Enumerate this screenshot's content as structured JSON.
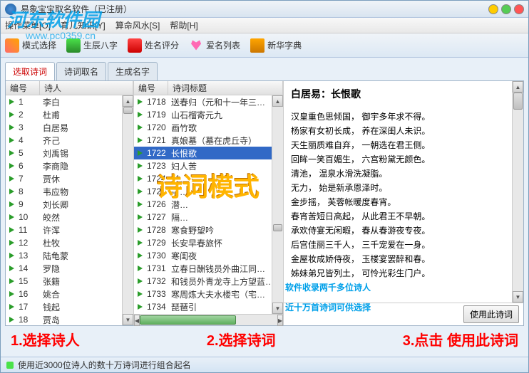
{
  "window": {
    "title": "易象宝宝取名软件（已注册）"
  },
  "menu": {
    "op": "操作菜单[O]",
    "child": "育儿知识[Y]",
    "fengshui": "算命风水[S]",
    "help": "帮助[H]"
  },
  "toolbar": {
    "mode": "模式选择",
    "bazi": "生辰八字",
    "score": "姓名评分",
    "love": "爱名列表",
    "dict": "新华字典"
  },
  "tabs": {
    "t1": "选取诗词",
    "t2": "诗词取名",
    "t3": "生成名字"
  },
  "headers": {
    "no": "编号",
    "poet": "诗人",
    "title": "诗词标题"
  },
  "poets": [
    {
      "n": "1",
      "name": "李白"
    },
    {
      "n": "2",
      "name": "杜甫"
    },
    {
      "n": "3",
      "name": "白居易"
    },
    {
      "n": "4",
      "name": "齐己"
    },
    {
      "n": "5",
      "name": "刘禹锡"
    },
    {
      "n": "6",
      "name": "李商隐"
    },
    {
      "n": "7",
      "name": "贾休"
    },
    {
      "n": "8",
      "name": "韦应物"
    },
    {
      "n": "9",
      "name": "刘长卿"
    },
    {
      "n": "10",
      "name": "皎然"
    },
    {
      "n": "11",
      "name": "许浑"
    },
    {
      "n": "12",
      "name": "杜牧"
    },
    {
      "n": "13",
      "name": "陆龟蒙"
    },
    {
      "n": "14",
      "name": "罗隐"
    },
    {
      "n": "15",
      "name": "张籍"
    },
    {
      "n": "16",
      "name": "姚合"
    },
    {
      "n": "17",
      "name": "钱起"
    },
    {
      "n": "18",
      "name": "贾岛"
    }
  ],
  "poems": [
    {
      "n": "1718",
      "t": "送春归（元和十一年三…"
    },
    {
      "n": "1719",
      "t": "山石榴寄元九"
    },
    {
      "n": "1720",
      "t": "画竹歌"
    },
    {
      "n": "1721",
      "t": "真娘墓（墓在虎丘寺）"
    },
    {
      "n": "1722",
      "t": "长恨歌",
      "sel": true
    },
    {
      "n": "1723",
      "t": "妇人苦"
    },
    {
      "n": "1724",
      "t": "长…"
    },
    {
      "n": "1725",
      "t": "昆…"
    },
    {
      "n": "1726",
      "t": "潜…"
    },
    {
      "n": "1727",
      "t": "隔…"
    },
    {
      "n": "1728",
      "t": "寒食野望吟"
    },
    {
      "n": "1729",
      "t": "长安早春旅怀"
    },
    {
      "n": "1730",
      "t": "寒闺夜"
    },
    {
      "n": "1731",
      "t": "立春日酬钱员外曲江同…"
    },
    {
      "n": "1732",
      "t": "和钱员外青龙寺上方望蓝…"
    },
    {
      "n": "1733",
      "t": "寒周炼大夫水楼宅（宅…"
    },
    {
      "n": "1734",
      "t": "琵琶引"
    }
  ],
  "poem": {
    "head": "白居易：长恨歌",
    "lines": [
      "汉皇重色思倾国，    御宇多年求不得。",
      "杨家有女初长成，    养在深闺人未识。",
      "天生丽质难自弃，    一朝选在君王侧。",
      "回眸一笑百媚生，    六宫粉黛无颜色。",
      "            清池，    温泉水滑洗凝脂。",
      "            无力，    始是新承恩泽时。",
      "            金步摇，  芙蓉帐暖度春宵。",
      "春宵苦短日高起，    从此君王不早朝。",
      "承欢侍宴无闲暇，    春从春游夜专夜。",
      "后宫佳丽三千人，    三千宠爱在一身。",
      "金屋妆成娇侍夜，    玉楼宴罢醉和春。",
      "姊妹弟兄皆列土，    可怜光彩生门户。"
    ]
  },
  "overlay": {
    "mode": "诗词模式",
    "promo1": "软件收录两千多位诗人",
    "promo2": "近十万首诗词可供选择"
  },
  "steps": {
    "s1": "1.选择诗人",
    "s2": "2.选择诗词",
    "s3": "3.点击   使用此诗词"
  },
  "buttons": {
    "use": "使用此诗词"
  },
  "status": {
    "text": "使用近3000位诗人的数十万诗词进行组合起名"
  },
  "watermark": {
    "main": "河东软件园",
    "sub": "www.pc0359.cn"
  }
}
